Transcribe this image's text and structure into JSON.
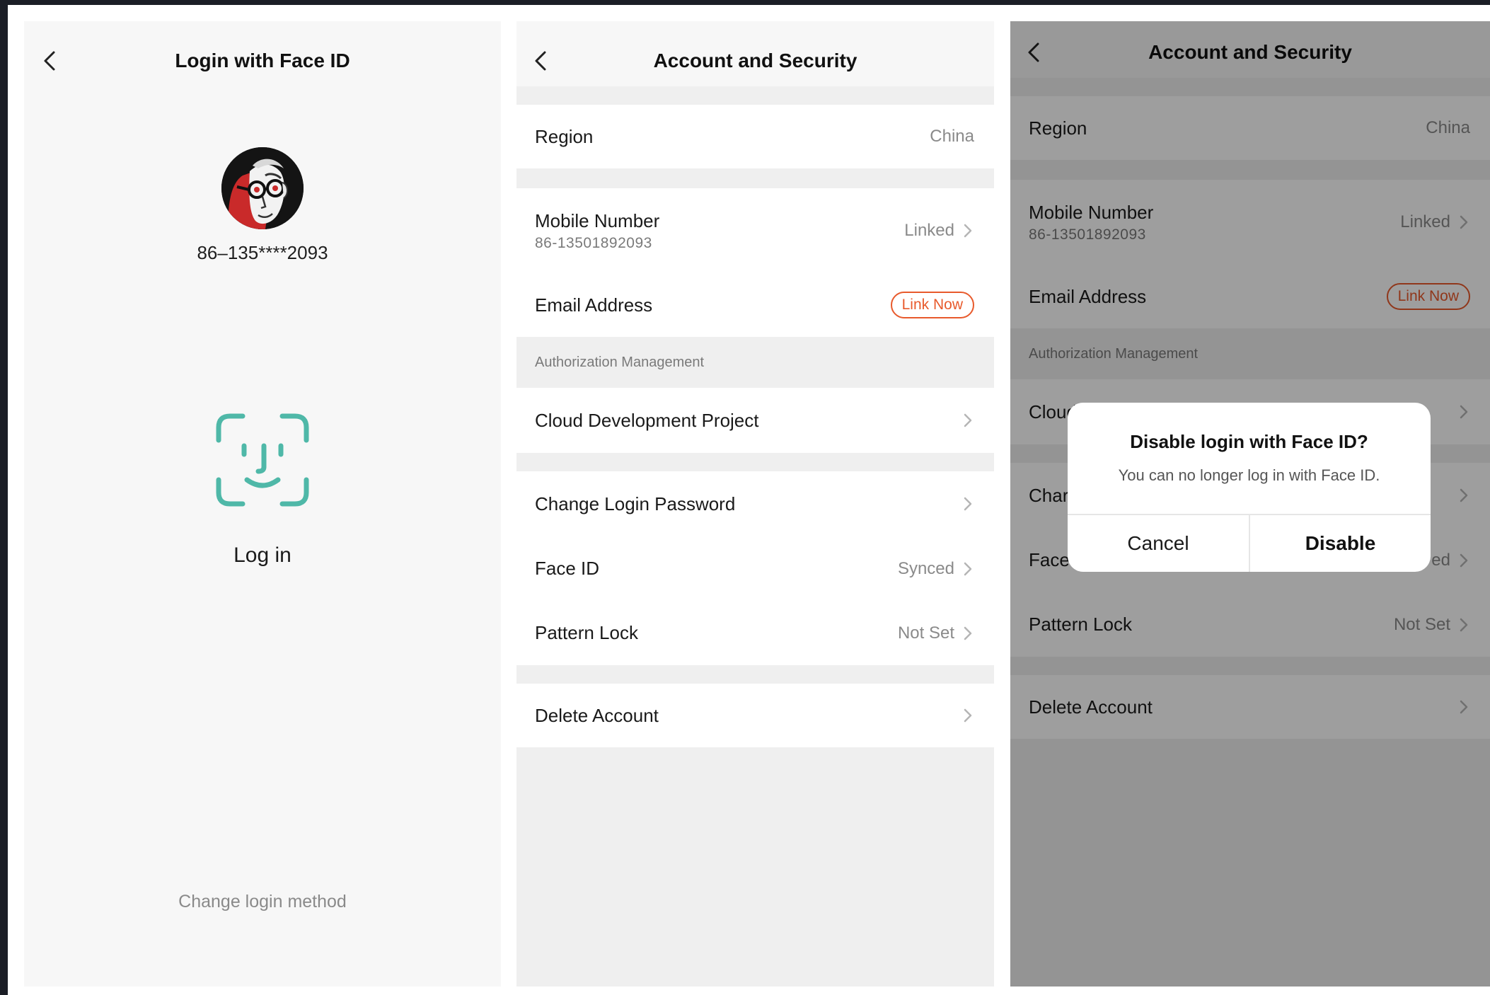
{
  "colors": {
    "accent": "#e85a2c",
    "faceid": "#4fb8a8",
    "background": "#f7f7f7",
    "divider": "#efefef"
  },
  "login_screen": {
    "title": "Login with Face ID",
    "back_icon": "chevron-left-icon",
    "account_number": "86–135****2093",
    "faceid_icon": "face-id-icon",
    "login_label": "Log in",
    "change_method": "Change login method"
  },
  "security_screen": {
    "title": "Account and Security",
    "back_icon": "chevron-left-icon",
    "region": {
      "label": "Region",
      "value": "China"
    },
    "mobile": {
      "label": "Mobile Number",
      "number": "86-13501892093",
      "value": "Linked"
    },
    "email": {
      "label": "Email Address",
      "action": "Link Now"
    },
    "auth_header": "Authorization Management",
    "cloud_project": {
      "label": "Cloud Development Project"
    },
    "change_password": {
      "label": "Change Login Password"
    },
    "face_id": {
      "label": "Face ID",
      "value": "Synced"
    },
    "pattern_lock": {
      "label": "Pattern Lock",
      "value": "Not Set"
    },
    "delete_account": {
      "label": "Delete Account"
    }
  },
  "dialog_screen": {
    "visible_face_label": "Face",
    "visible_face_value": "ed",
    "visible_cloud_label": "Cloud",
    "visible_change_label": "Char"
  },
  "dialog": {
    "title": "Disable login with Face ID?",
    "message": "You can no longer log in with Face ID.",
    "cancel": "Cancel",
    "confirm": "Disable"
  }
}
